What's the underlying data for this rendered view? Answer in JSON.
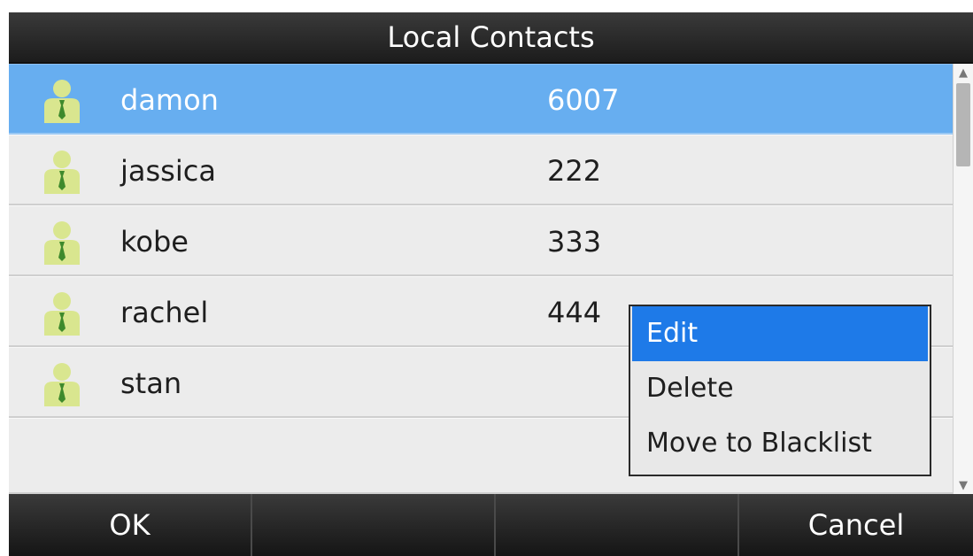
{
  "title": "Local Contacts",
  "contacts": [
    {
      "name": "damon",
      "number": "6007",
      "selected": true
    },
    {
      "name": "jassica",
      "number": "222"
    },
    {
      "name": "kobe",
      "number": "333"
    },
    {
      "name": "rachel",
      "number": "444"
    },
    {
      "name": "stan",
      "number": ""
    }
  ],
  "context_menu": {
    "items": [
      "Edit",
      "Delete",
      "Move to Blacklist"
    ],
    "active_index": 0
  },
  "softkeys": [
    "OK",
    "",
    "",
    "Cancel"
  ],
  "colors": {
    "selected_row": "#67aef0",
    "menu_active": "#1e7ae8",
    "avatar_body": "#d9e68f",
    "avatar_tie": "#3e8a2c"
  },
  "icons": {
    "contact": "person-avatar-icon",
    "scroll_up": "triangle-up-icon",
    "scroll_down": "triangle-down-icon"
  }
}
